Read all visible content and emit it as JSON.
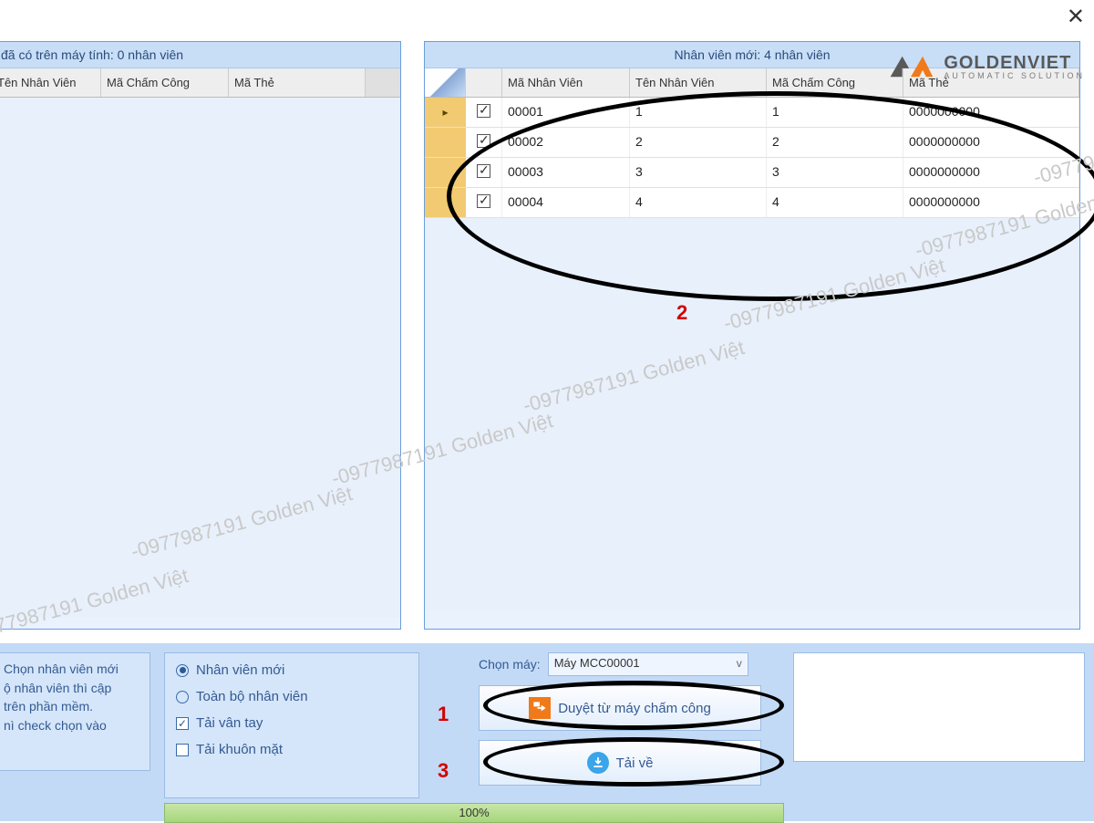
{
  "close_label": "✕",
  "left_panel": {
    "title": "đã có trên máy tính: 0 nhân viên",
    "headers": [
      "Tên Nhân Viên",
      "Mã Chấm Công",
      "Mã Thẻ"
    ]
  },
  "right_panel": {
    "title": "Nhân viên mới: 4 nhân viên",
    "headers": [
      "Mã Nhân Viên",
      "Tên Nhân Viên",
      "Mã Chấm Công",
      "Mã Thẻ"
    ],
    "rows": [
      {
        "selected": true,
        "pointer": true,
        "ma_nv": "00001",
        "ten": "1",
        "mcc": "1",
        "mt": "0000000000"
      },
      {
        "selected": true,
        "pointer": false,
        "ma_nv": "00002",
        "ten": "2",
        "mcc": "2",
        "mt": "0000000000"
      },
      {
        "selected": true,
        "pointer": false,
        "ma_nv": "00003",
        "ten": "3",
        "mcc": "3",
        "mt": "0000000000"
      },
      {
        "selected": true,
        "pointer": false,
        "ma_nv": "00004",
        "ten": "4",
        "mcc": "4",
        "mt": "0000000000"
      }
    ]
  },
  "help_lines": [
    "Chọn nhân viên mới",
    "ộ nhân viên thì cập",
    "trên phần mềm.",
    "nì check chọn vào"
  ],
  "options": {
    "radio_new": "Nhân viên mới",
    "radio_all": "Toàn bộ nhân viên",
    "chk_finger": "Tải vân tay",
    "chk_face": "Tải khuôn mặt"
  },
  "selector": {
    "label": "Chọn máy:",
    "value": "Máy MCC00001"
  },
  "buttons": {
    "browse": "Duyệt từ máy chấm công",
    "download": "Tải về"
  },
  "progress": "100%",
  "annotations": {
    "n1": "1",
    "n2": "2",
    "n3": "3"
  },
  "watermark": "-0977987191 Golden Việt ",
  "logo": {
    "main": "GOLDENVIET",
    "sub": "AUTOMATIC SOLUTION"
  }
}
